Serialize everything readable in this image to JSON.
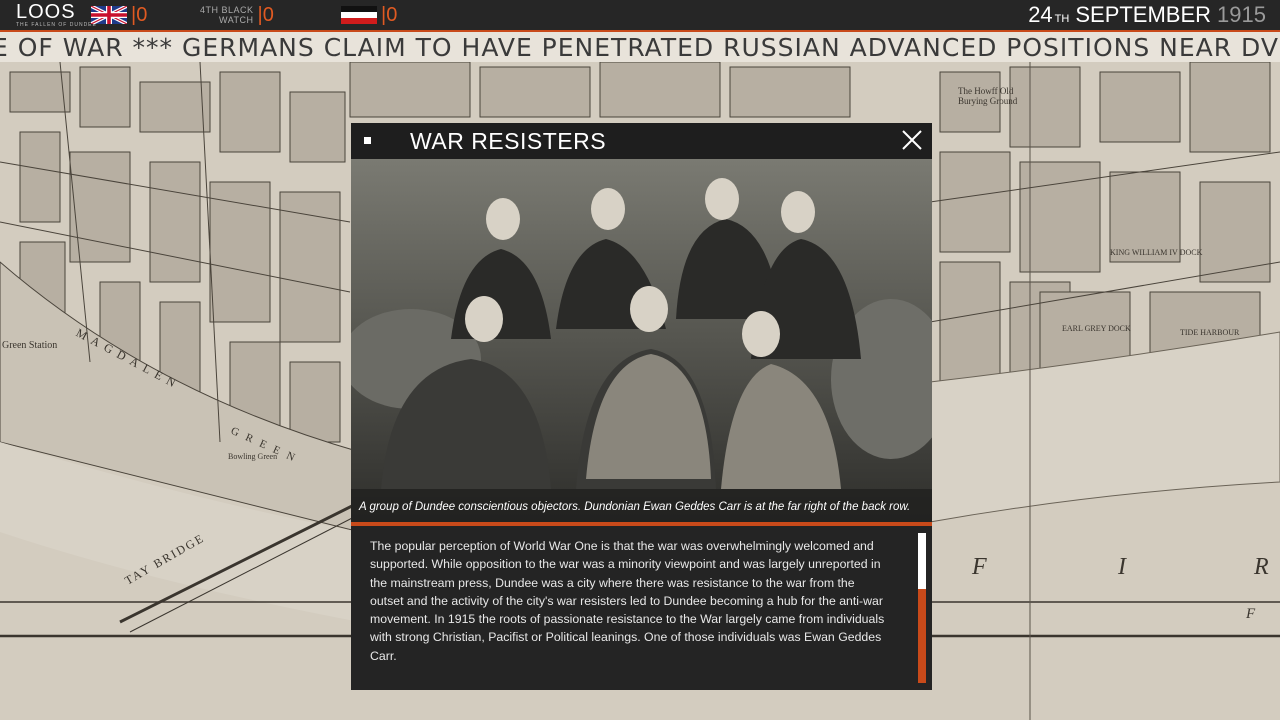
{
  "topbar": {
    "battle_title": "LOOS",
    "battle_subtitle": "THE FALLEN OF DUNDEE",
    "uk_count": "0",
    "bw_label_line1": "4TH BLACK",
    "bw_label_line2": "WATCH",
    "bw_count": "0",
    "de_count": "0",
    "date_day": "24",
    "date_suffix": "TH",
    "date_month": "SEPTEMBER",
    "date_year": "1915",
    "accent_color": "#c84a1a"
  },
  "ticker": {
    "text": "E OF WAR *** GERMANS CLAIM TO HAVE PENETRATED RUSSIAN ADVANCED POSITIONS NEAR DVINSK *"
  },
  "map": {
    "labels": [
      "Green Station",
      "MAGDALEN",
      "GREEN",
      "Bowling Green",
      "TAY BRIDGE",
      "The Howff Old Burying Ground",
      "EARL GREY DOCK",
      "TIDE HARBOUR",
      "KING WILLIAM IV DOCK",
      "F",
      "I",
      "R",
      "F"
    ]
  },
  "modal": {
    "title": "WAR RESISTERS",
    "close_icon": "close-icon",
    "caption": "A group of Dundee conscientious objectors. Dundonian Ewan Geddes Carr is at the far right of the back row.",
    "body_lines": [
      "The popular perception of World War One is that the war was overwhelmingly welcomed and",
      "supported. While opposition to the war was a minority viewpoint and was largely unreported in",
      "the mainstream press, Dundee was a city where there was resistance to the war from the",
      "outset and the activity of the city's war resisters led to Dundee becoming a hub for the anti-war",
      "movement. In 1915 the roots of passionate resistance to the War largely came from individuals",
      "with strong Christian, Pacifist or Political leanings. One of those individuals was Ewan Geddes",
      "Carr."
    ]
  }
}
